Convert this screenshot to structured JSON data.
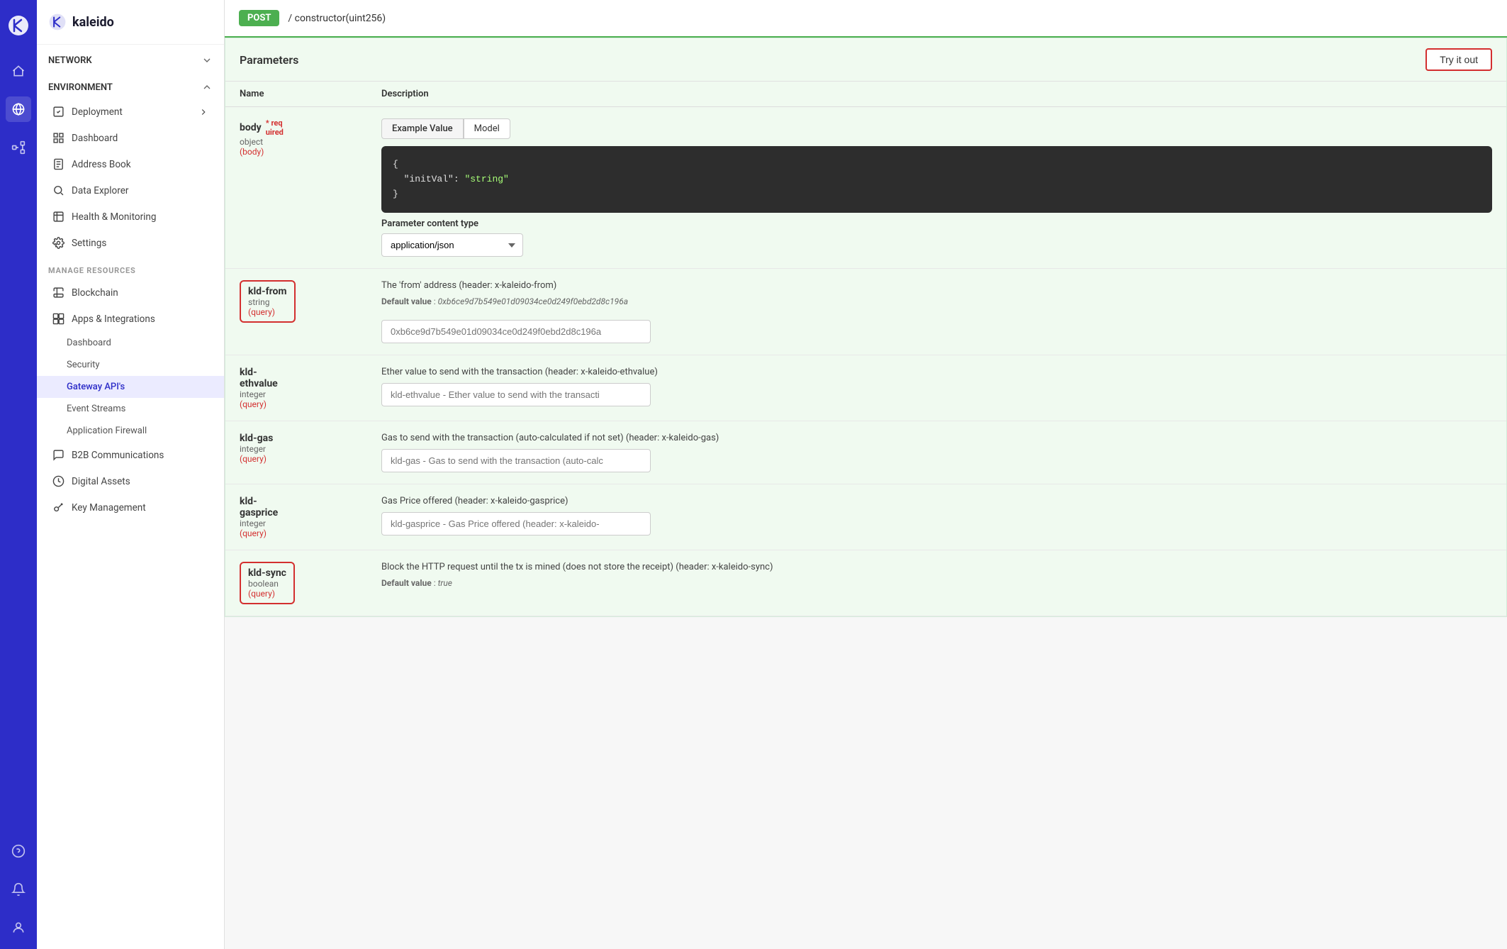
{
  "brand": {
    "name": "kaleido",
    "logoColor": "#2d2dc8"
  },
  "iconBar": {
    "items": [
      {
        "name": "home-icon",
        "symbol": "⌂"
      },
      {
        "name": "globe-icon",
        "symbol": "◎"
      },
      {
        "name": "nodes-icon",
        "symbol": "⬡"
      },
      {
        "name": "question-icon",
        "symbol": "?"
      },
      {
        "name": "bell-icon",
        "symbol": "🔔"
      },
      {
        "name": "user-icon",
        "symbol": "👤"
      }
    ]
  },
  "sidebar": {
    "network_section": "NETWORK",
    "environment_section": "ENVIRONMENT",
    "deployment_label": "Deployment",
    "dashboard_label": "Dashboard",
    "address_book_label": "Address Book",
    "data_explorer_label": "Data Explorer",
    "health_monitoring_label": "Health & Monitoring",
    "settings_label": "Settings",
    "manage_resources_label": "MANAGE RESOURCES",
    "blockchain_label": "Blockchain",
    "apps_integrations_label": "Apps & Integrations",
    "apps_dashboard_label": "Dashboard",
    "apps_security_label": "Security",
    "gateway_apis_label": "Gateway API's",
    "event_streams_label": "Event Streams",
    "app_firewall_label": "Application Firewall",
    "b2b_comms_label": "B2B Communications",
    "digital_assets_label": "Digital Assets",
    "key_management_label": "Key Management"
  },
  "endpoint": {
    "method": "POST",
    "path": "/  constructor(uint256)"
  },
  "parameters": {
    "title": "Parameters",
    "try_it_out": "Try it out",
    "col_name": "Name",
    "col_description": "Description",
    "params": [
      {
        "name": "body",
        "required": "* req",
        "required2": "uired",
        "type": "object",
        "location": "(body)",
        "highlighted": false,
        "tab_example": "Example Value",
        "tab_model": "Model",
        "code": "{\n  \"initVal\": \"string\"\n}",
        "content_type_label": "Parameter content type",
        "content_type_value": "application/json"
      },
      {
        "name": "kld-from",
        "type": "string",
        "location": "(query)",
        "highlighted": true,
        "description": "The 'from' address (header: x-kaleido-from)",
        "default_label": "Default value",
        "default_value": "0xb6ce9d7b549e01d09034ce0d249f0ebd2d8c196a",
        "input_placeholder": "0xb6ce9d7b549e01d09034ce0d249f0ebd2d8c196a"
      },
      {
        "name": "kld-ethvalue",
        "type": "integer",
        "location": "(query)",
        "highlighted": false,
        "description": "Ether value to send with the transaction (header: x-kaleido-ethvalue)",
        "input_placeholder": "kld-ethvalue - Ether value to send with the transacti"
      },
      {
        "name": "kld-gas",
        "type": "integer",
        "location": "(query)",
        "highlighted": false,
        "description": "Gas to send with the transaction (auto-calculated if not set) (header: x-kaleido-gas)",
        "input_placeholder": "kld-gas - Gas to send with the transaction (auto-calc"
      },
      {
        "name": "kld-gasprice",
        "type": "integer",
        "location": "(query)",
        "highlighted": false,
        "description": "Gas Price offered (header: x-kaleido-gasprice)",
        "input_placeholder": "kld-gasprice - Gas Price offered (header: x-kaleido-"
      },
      {
        "name": "kld-sync",
        "type": "boolean",
        "location": "(query)",
        "highlighted": true,
        "description": "Block the HTTP request until the tx is mined (does not store the receipt) (header: x-kaleido-sync)",
        "default_label": "Default value",
        "default_value": "true"
      }
    ]
  }
}
